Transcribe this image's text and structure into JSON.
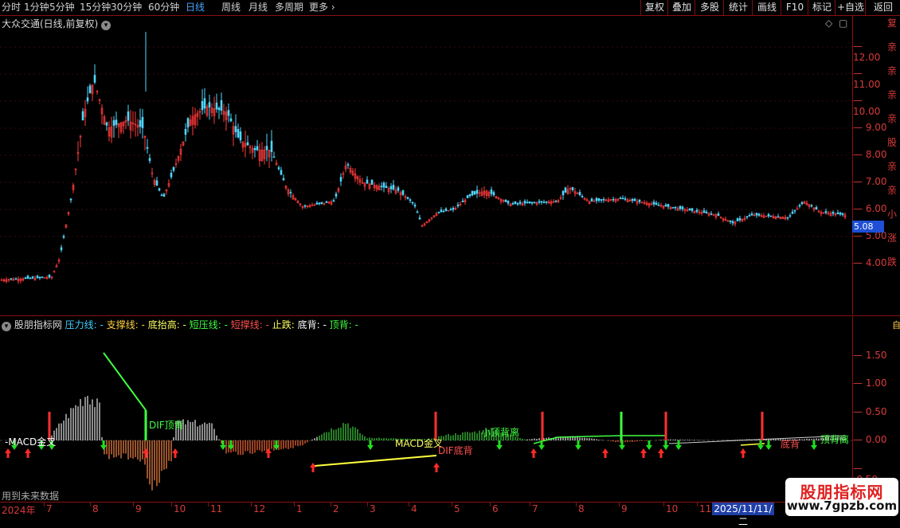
{
  "toolbar": {
    "periods": [
      "分时",
      "1分钟",
      "5分钟",
      "15分钟",
      "30分钟",
      "60分钟",
      "日线",
      "周线",
      "月线",
      "多周期",
      "更多"
    ],
    "active_period": "日线",
    "right_buttons": [
      "复权",
      "叠加",
      "多股",
      "统计",
      "画线",
      "F10",
      "标记",
      "+自选",
      "返回"
    ]
  },
  "main_panel": {
    "title": "大众交通(日线,前复权)",
    "price_ticks": [
      "12.00",
      "11.00",
      "10.00",
      "9.00",
      "8.00",
      "7.00",
      "6.00",
      "5.00",
      "4.00"
    ],
    "current_price": "5.08",
    "right_vertical_text": "复亲亲亲亲股亲亲小涨跌"
  },
  "indicator_panel": {
    "name": "股朋指标网",
    "legend": [
      {
        "label": "压力线: -",
        "color": "#3fd0ff"
      },
      {
        "label": "支撑线: -",
        "color": "#ffd23f"
      },
      {
        "label": "底抬高: -",
        "color": "#ffff60"
      },
      {
        "label": "短压线: -",
        "color": "#40ff40"
      },
      {
        "label": "短撑线: -",
        "color": "#ff5050"
      },
      {
        "label": "止跌: ",
        "color": "#ffff60"
      },
      {
        "label": "底背: -",
        "color": "#ffffff"
      },
      {
        "label": "顶背: -",
        "color": "#40ff40"
      }
    ],
    "ticks": [
      "1.50",
      "1.00",
      "0.50",
      "0.00",
      "-0.50"
    ],
    "signals": [
      {
        "text": "-MACD金叉",
        "color": "#ffffff"
      },
      {
        "text": "DIF顶背",
        "color": "#40ff40"
      },
      {
        "text": "MACD金叉",
        "color": "#ffff60"
      },
      {
        "text": "DIF底背",
        "color": "#ff5050"
      },
      {
        "text": "小顶背离",
        "color": "#40ff40"
      },
      {
        "text": "底背",
        "color": "#ff5050"
      },
      {
        "text": "顶背离",
        "color": "#40ff40"
      }
    ]
  },
  "time_axis": {
    "labels": [
      "2024年",
      "7",
      "8",
      "9",
      "10",
      "11",
      "12",
      "1",
      "2",
      "3",
      "4",
      "5",
      "6",
      "7",
      "8",
      "9",
      "10",
      "11"
    ],
    "cursor_date": "2025/11/11/二",
    "future_note": "用到未来数据"
  },
  "logo": {
    "line1": "股朋指标网",
    "line2": "www.7gpzb.com"
  },
  "colors": {
    "up": "#ff3b3b",
    "down": "#4fd7ff",
    "frame": "#8a1010",
    "active": "#4aa3ff"
  }
}
